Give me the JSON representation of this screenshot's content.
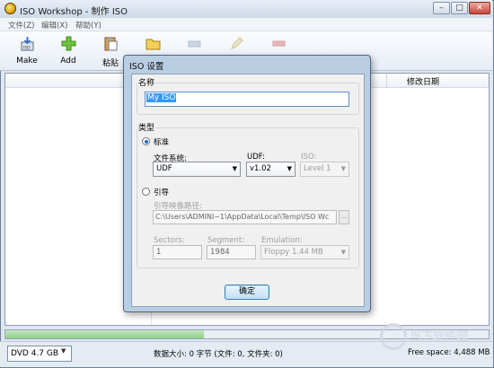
{
  "window": {
    "title": "ISO Workshop - 制作 ISO",
    "min": "–",
    "max": "□",
    "close": "✕"
  },
  "menu": [
    "文件(Z)",
    "编辑(X)",
    "帮助(Y)"
  ],
  "toolbar": [
    {
      "label": "Make",
      "icon": "iso-make-icon"
    },
    {
      "label": "Add",
      "icon": "add-plus-icon"
    },
    {
      "label": "粘贴",
      "icon": "paste-icon"
    },
    {
      "label": "",
      "icon": "folder-icon"
    }
  ],
  "list": {
    "col_date": "修改日期"
  },
  "progress": {
    "fill_fraction": 0.41
  },
  "status": {
    "media": "DVD 4.7 GB",
    "info": "数据大小: 0 字节 (文件: 0, 文件夹: 0)",
    "free": "Free space: 4,488 MB"
  },
  "watermark": "当下软件园",
  "dialog": {
    "title": "ISO 设置",
    "name_group": "名称",
    "name_value": "My ISO",
    "type_group": "类型",
    "standard": "标准",
    "fs_label": "文件系统:",
    "fs_value": "UDF",
    "udf_label": "UDF:",
    "udf_value": "v1.02",
    "iso_label": "ISO:",
    "iso_value": "Level 1",
    "boot": "引导",
    "bootpath_label": "引导映像路径:",
    "bootpath_value": "C:\\Users\\ADMINI~1\\AppData\\Local\\Temp\\ISO Wc",
    "browse": "...",
    "sectors_label": "Sectors:",
    "sectors_value": "1",
    "segment_label": "Segment:",
    "segment_value": "1984",
    "emulation_label": "Emulation:",
    "emulation_value": "Floppy 1.44 MB",
    "ok": "确定"
  }
}
